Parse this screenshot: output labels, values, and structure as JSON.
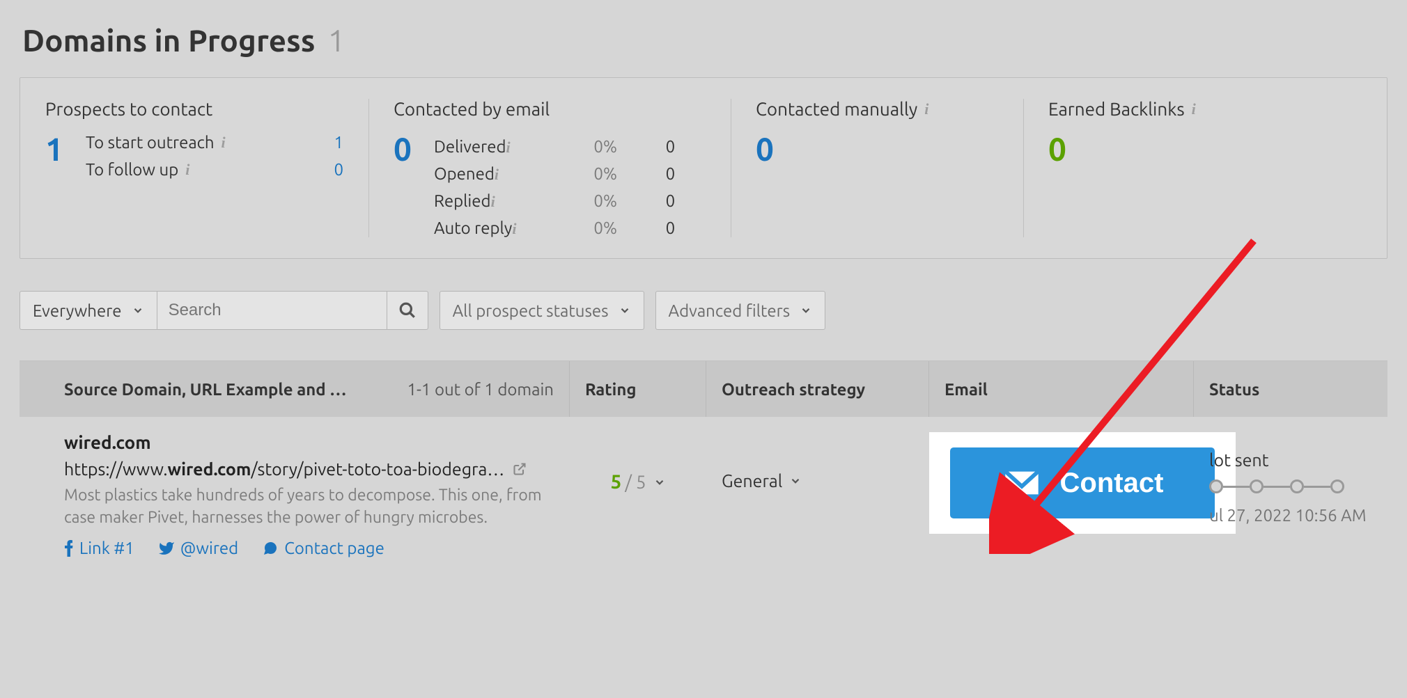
{
  "header": {
    "title": "Domains in Progress",
    "count": "1"
  },
  "stats": {
    "prospects": {
      "label": "Prospects to contact",
      "total": "1",
      "start_label": "To start outreach",
      "start_val": "1",
      "follow_label": "To follow up",
      "follow_val": "0"
    },
    "email": {
      "label": "Contacted by email",
      "total": "0",
      "rows": {
        "delivered": {
          "label": "Delivered",
          "pct": "0%",
          "val": "0"
        },
        "opened": {
          "label": "Opened",
          "pct": "0%",
          "val": "0"
        },
        "replied": {
          "label": "Replied",
          "pct": "0%",
          "val": "0"
        },
        "autoreply": {
          "label": "Auto reply",
          "pct": "0%",
          "val": "0"
        }
      }
    },
    "manual": {
      "label": "Contacted manually",
      "total": "0"
    },
    "earned": {
      "label": "Earned Backlinks",
      "total": "0"
    }
  },
  "filters": {
    "scope": "Everywhere",
    "search_placeholder": "Search",
    "statuses": "All prospect statuses",
    "advanced": "Advanced filters"
  },
  "table": {
    "headers": {
      "source": "Source Domain, URL Example and …",
      "summary": "1-1 out of 1 domain",
      "rating": "Rating",
      "strategy": "Outreach strategy",
      "email": "Email",
      "status": "Status"
    },
    "row": {
      "domain": "wired.com",
      "url_prefix": "https://www.",
      "url_bold": "wired.com",
      "url_rest": "/story/pivet-toto-toa-biodegra…",
      "desc": "Most plastics take hundreds of years to decompose. This one, from case maker Pivet, harnesses the power of hungry microbes.",
      "link_1": "Link #1",
      "twitter": "@wired",
      "contact_page": "Contact page",
      "rating_val": "5",
      "rating_of": "/ 5",
      "strategy": "General",
      "contact_button": "Contact",
      "status_label": "lot sent",
      "status_date": "ul 27, 2022 10:56 AM"
    }
  }
}
